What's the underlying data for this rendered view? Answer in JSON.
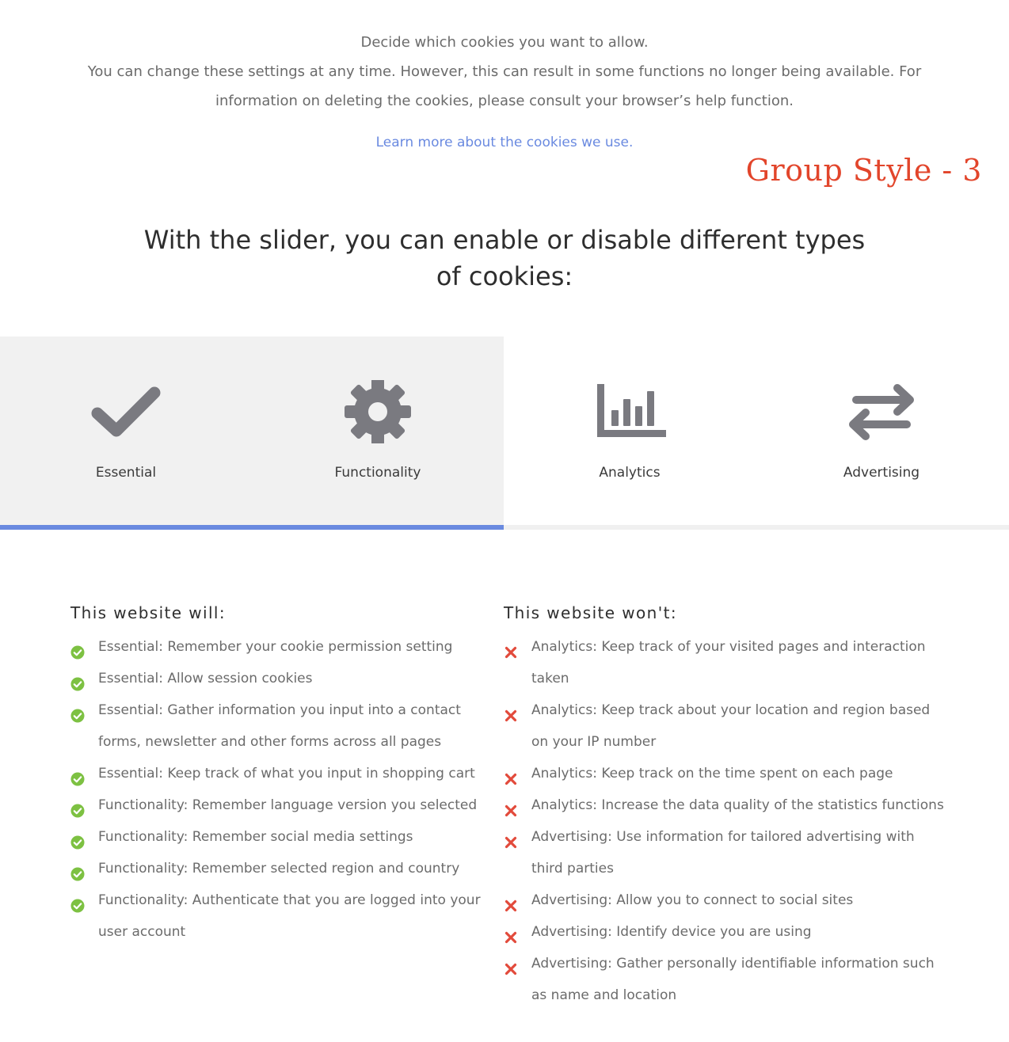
{
  "intro": {
    "heading": "Decide which cookies you want to allow.",
    "body": "You can change these settings at any time. However, this can result in some functions no longer being available. For information on deleting the cookies, please consult your browser’s help function.",
    "learn_more": "Learn more about the cookies we use."
  },
  "style_label": "Group Style - 3",
  "slider": {
    "heading": "With the slider, you can enable or disable different types of cookies:",
    "selected_level": 2,
    "categories": [
      {
        "label": "Essential",
        "icon": "checkmark-icon",
        "enabled": true
      },
      {
        "label": "Functionality",
        "icon": "gear-icon",
        "enabled": true
      },
      {
        "label": "Analytics",
        "icon": "bar-chart-icon",
        "enabled": false
      },
      {
        "label": "Advertising",
        "icon": "swap-arrows-icon",
        "enabled": false
      }
    ]
  },
  "colors": {
    "accent": "#6a8ae0",
    "allowed": "#7dc142",
    "denied": "#e24a3b",
    "style_label": "#e2452b",
    "icon": "#7a7a80"
  },
  "will": {
    "title": "This website will:",
    "items": [
      "Essential: Remember your cookie permission setting",
      "Essential: Allow session cookies",
      "Essential: Gather information you input into a contact forms, newsletter and other forms across all pages",
      "Essential: Keep track of what you input in shopping cart",
      "Functionality: Remember language version you selected",
      "Functionality: Remember social media settings",
      "Functionality: Remember selected region and country",
      "Functionality: Authenticate that you are logged into your user account"
    ]
  },
  "wont": {
    "title": "This website won't:",
    "items": [
      "Analytics: Keep track of your visited pages and interaction taken",
      "Analytics: Keep track about your location and region based on your IP number",
      "Analytics: Keep track on the time spent on each page",
      "Analytics: Increase the data quality of the statistics functions",
      "Advertising: Use information for tailored advertising with third parties",
      "Advertising: Allow you to connect to social sites",
      "Advertising: Identify device you are using",
      "Advertising: Gather personally identifiable information such as name and location"
    ]
  }
}
